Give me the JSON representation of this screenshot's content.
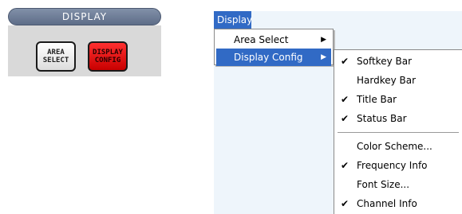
{
  "hardkey_panel": {
    "header": "DISPLAY",
    "keys": [
      {
        "line1": "AREA",
        "line2": "SELECT"
      },
      {
        "line1": "DISPLAY",
        "line2": "CONFIG"
      }
    ]
  },
  "menubar": {
    "display": "Display"
  },
  "display_menu": {
    "items": [
      {
        "label": "Area Select",
        "arrow": "▶"
      },
      {
        "label": "Display Config",
        "arrow": "▶"
      }
    ]
  },
  "display_config_menu": {
    "items": [
      {
        "label": "Softkey Bar",
        "checked": "✔"
      },
      {
        "label": "Hardkey Bar",
        "checked": ""
      },
      {
        "label": "Title Bar",
        "checked": "✔"
      },
      {
        "label": "Status Bar",
        "checked": "✔"
      },
      {
        "label": "Color Scheme...",
        "checked": ""
      },
      {
        "label": "Frequency Info",
        "checked": "✔"
      },
      {
        "label": "Font Size...",
        "checked": ""
      },
      {
        "label": "Channel Info",
        "checked": "✔"
      }
    ]
  },
  "colors": {
    "highlight": "#316ac5",
    "display_key": "#e01010"
  }
}
